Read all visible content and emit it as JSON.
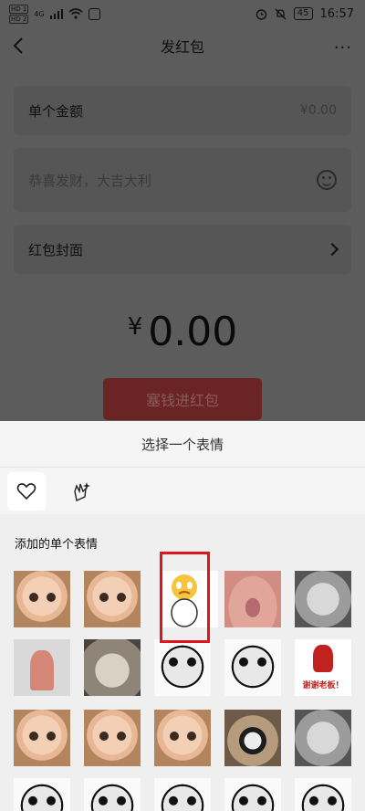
{
  "status_bar": {
    "sim1": "HD 1",
    "sim2": "HD 2",
    "network": "4G",
    "battery": "45",
    "time": "16:57"
  },
  "nav": {
    "title": "发红包",
    "more": "···"
  },
  "form": {
    "amount_label": "单个金额",
    "amount_value": "¥0.00",
    "greeting_placeholder": "恭喜发财，大吉大利",
    "cover_label": "红包封面"
  },
  "total": {
    "currency": "¥",
    "amount": "0.00"
  },
  "send_button": "塞钱进红包",
  "sheet": {
    "title": "选择一个表情",
    "section_label": "添加的单个表情",
    "sticker_text": "谢谢老板！",
    "tabs": [
      "heart-icon",
      "sparkle-hand-icon"
    ]
  },
  "colors": {
    "overlay_bg": "#5c5c5c",
    "button": "#6a2424",
    "highlight": "#e0151b"
  }
}
